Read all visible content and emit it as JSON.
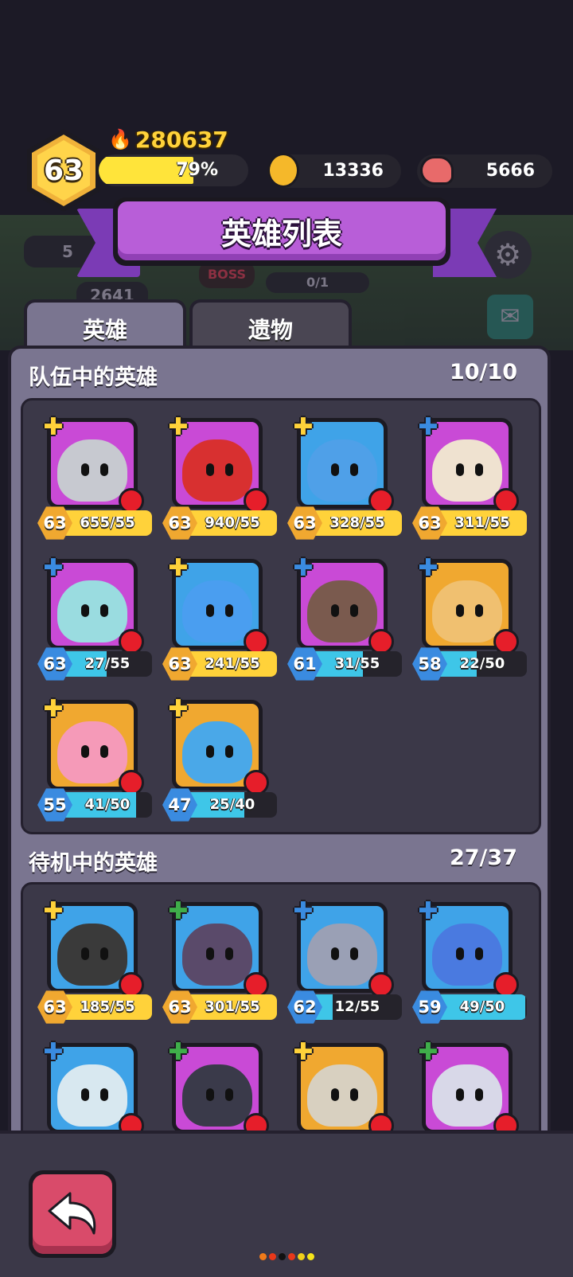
{
  "player": {
    "level": "63",
    "power": "280637",
    "xp_percent": "79%",
    "xp_fraction": 0.79
  },
  "resources": {
    "gold": "13336",
    "meat": "5666"
  },
  "title": "英雄列表",
  "background": {
    "meat_partial": "5",
    "score_partial": "2641",
    "boss": "BOSS",
    "progress": "0/1"
  },
  "tabs": [
    {
      "label": "英雄",
      "active": true
    },
    {
      "label": "遗物",
      "active": false
    }
  ],
  "team": {
    "title": "队伍中的英雄",
    "count": "10/10",
    "heroes": [
      {
        "level": "63",
        "progress": "655/55",
        "fill": 1.0,
        "style": "gold",
        "badge": "gold"
      },
      {
        "level": "63",
        "progress": "940/55",
        "fill": 1.0,
        "style": "gold",
        "badge": "gold"
      },
      {
        "level": "63",
        "progress": "328/55",
        "fill": 1.0,
        "style": "gold",
        "badge": "gold"
      },
      {
        "level": "63",
        "progress": "311/55",
        "fill": 1.0,
        "style": "gold",
        "badge": "blue"
      },
      {
        "level": "63",
        "progress": "27/55",
        "fill": 0.49,
        "style": "blue",
        "badge": "blue"
      },
      {
        "level": "63",
        "progress": "241/55",
        "fill": 1.0,
        "style": "gold",
        "badge": "gold"
      },
      {
        "level": "61",
        "progress": "31/55",
        "fill": 0.56,
        "style": "blue",
        "badge": "blue"
      },
      {
        "level": "58",
        "progress": "22/50",
        "fill": 0.44,
        "style": "blue",
        "badge": "blue"
      },
      {
        "level": "55",
        "progress": "41/50",
        "fill": 0.82,
        "style": "blue",
        "badge": "gold"
      },
      {
        "level": "47",
        "progress": "25/40",
        "fill": 0.63,
        "style": "blue",
        "badge": "gold"
      }
    ]
  },
  "standby": {
    "title": "待机中的英雄",
    "count": "27/37",
    "heroes": [
      {
        "level": "63",
        "progress": "185/55",
        "fill": 1.0,
        "style": "gold",
        "badge": "gold"
      },
      {
        "level": "63",
        "progress": "301/55",
        "fill": 1.0,
        "style": "gold",
        "badge": "green"
      },
      {
        "level": "62",
        "progress": "12/55",
        "fill": 0.22,
        "style": "blue",
        "badge": "blue"
      },
      {
        "level": "59",
        "progress": "49/50",
        "fill": 0.98,
        "style": "blue",
        "badge": "blue"
      },
      {
        "badge": "blue"
      },
      {
        "badge": "green"
      },
      {
        "badge": "gold"
      },
      {
        "badge": "green"
      }
    ]
  },
  "colors": {
    "accent_purple": "#b85ed8",
    "gold": "#ffd23a",
    "blue": "#3ec6e8",
    "panel": "#7a7590"
  }
}
